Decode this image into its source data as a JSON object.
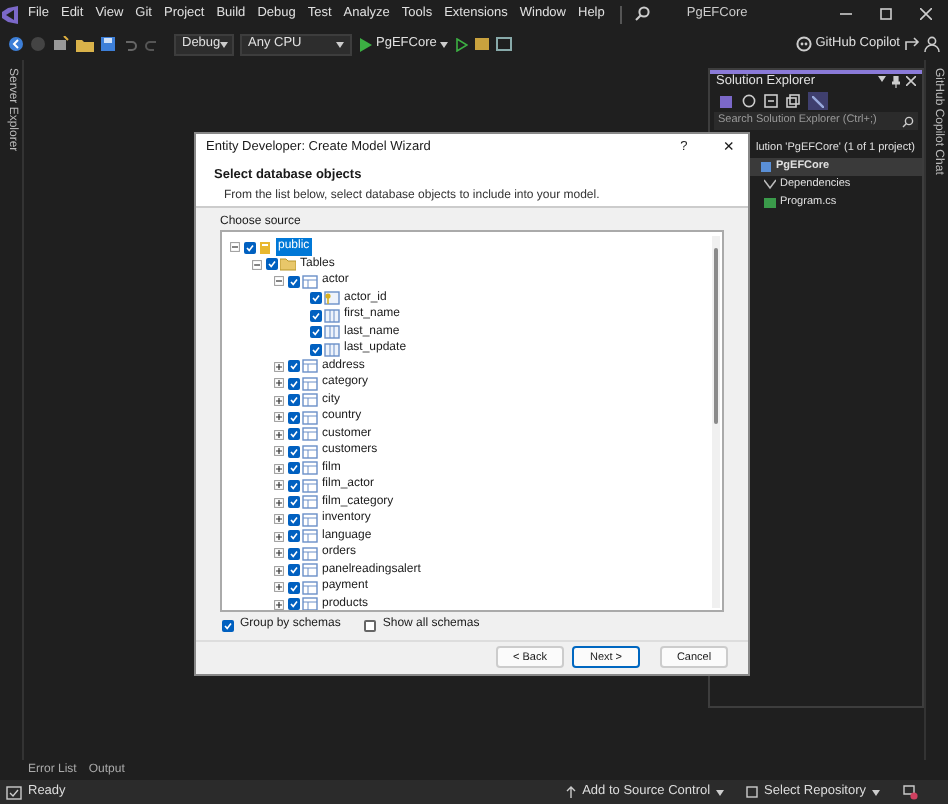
{
  "menu": [
    "File",
    "Edit",
    "View",
    "Git",
    "Project",
    "Build",
    "Debug",
    "Test",
    "Analyze",
    "Tools",
    "Extensions",
    "Window",
    "Help"
  ],
  "title": "PgEFCore",
  "toolbar": {
    "configuration": "Debug",
    "platform": "Any CPU",
    "start_target": "PgEFCore",
    "copilot": "GitHub Copilot"
  },
  "side_tabs": {
    "left": "Server Explorer",
    "right": "GitHub Copilot Chat"
  },
  "solution_explorer": {
    "title": "Solution Explorer",
    "search_placeholder": "Search Solution Explorer (Ctrl+;)",
    "items": [
      {
        "label": "lution 'PgEFCore' (1 of 1 project)",
        "selected": false,
        "children": [
          {
            "label": "PgEFCore",
            "kind": "project",
            "selected": true,
            "children": [
              {
                "label": "Dependencies",
                "kind": "dependencies",
                "selected": false
              },
              {
                "label": "Program.cs",
                "kind": "csharp",
                "selected": false
              }
            ]
          }
        ]
      }
    ]
  },
  "dialog": {
    "title": "Entity Developer: Create Model Wizard",
    "help": "?",
    "close": "×",
    "heading": "Select database objects",
    "description": "From the list below, select database objects to include into your model.",
    "source_label": "Choose source",
    "tree": [
      {
        "label": "public",
        "kind": "schema",
        "checked": true,
        "expanded": true,
        "selected": true,
        "children": [
          {
            "label": "Tables",
            "kind": "folder",
            "checked": true,
            "expanded": true,
            "selected": false,
            "children": [
              {
                "label": "actor",
                "kind": "table",
                "checked": true,
                "expanded": true,
                "selected": false,
                "children": [
                  {
                    "label": "actor_id",
                    "kind": "key_column",
                    "checked": true,
                    "selected": false
                  },
                  {
                    "label": "first_name",
                    "kind": "column",
                    "checked": true,
                    "selected": false
                  },
                  {
                    "label": "last_name",
                    "kind": "column",
                    "checked": true,
                    "selected": false
                  },
                  {
                    "label": "last_update",
                    "kind": "column",
                    "checked": true,
                    "selected": false
                  }
                ]
              },
              {
                "label": "address",
                "kind": "table",
                "checked": true,
                "expanded": false,
                "selected": false
              },
              {
                "label": "category",
                "kind": "table",
                "checked": true,
                "expanded": false,
                "selected": false
              },
              {
                "label": "city",
                "kind": "table",
                "checked": true,
                "expanded": false,
                "selected": false
              },
              {
                "label": "country",
                "kind": "table",
                "checked": true,
                "expanded": false,
                "selected": false
              },
              {
                "label": "customer",
                "kind": "table",
                "checked": true,
                "expanded": false,
                "selected": false
              },
              {
                "label": "customers",
                "kind": "table",
                "checked": true,
                "expanded": false,
                "selected": false
              },
              {
                "label": "film",
                "kind": "table",
                "checked": true,
                "expanded": false,
                "selected": false
              },
              {
                "label": "film_actor",
                "kind": "table",
                "checked": true,
                "expanded": false,
                "selected": false
              },
              {
                "label": "film_category",
                "kind": "table",
                "checked": true,
                "expanded": false,
                "selected": false
              },
              {
                "label": "inventory",
                "kind": "table",
                "checked": true,
                "expanded": false,
                "selected": false
              },
              {
                "label": "language",
                "kind": "table",
                "checked": true,
                "expanded": false,
                "selected": false
              },
              {
                "label": "orders",
                "kind": "table",
                "checked": true,
                "expanded": false,
                "selected": false
              },
              {
                "label": "panelreadingsalert",
                "kind": "table",
                "checked": true,
                "expanded": false,
                "selected": false
              },
              {
                "label": "payment",
                "kind": "table",
                "checked": true,
                "expanded": false,
                "selected": false
              },
              {
                "label": "products",
                "kind": "table",
                "checked": true,
                "expanded": false,
                "selected": false
              }
            ]
          }
        ]
      }
    ],
    "options": [
      {
        "label": "Group by schemas",
        "checked": true
      },
      {
        "label": "Show all schemas",
        "checked": false
      }
    ],
    "buttons": [
      {
        "label": "< Back",
        "default": false
      },
      {
        "label": "Next >",
        "default": true
      },
      {
        "label": "Cancel",
        "default": false
      }
    ]
  },
  "bottom_tabs": [
    "Error List",
    "Output"
  ],
  "status_bar": {
    "text": "Ready",
    "source_control": "Add to Source Control",
    "repository": "Select Repository"
  }
}
